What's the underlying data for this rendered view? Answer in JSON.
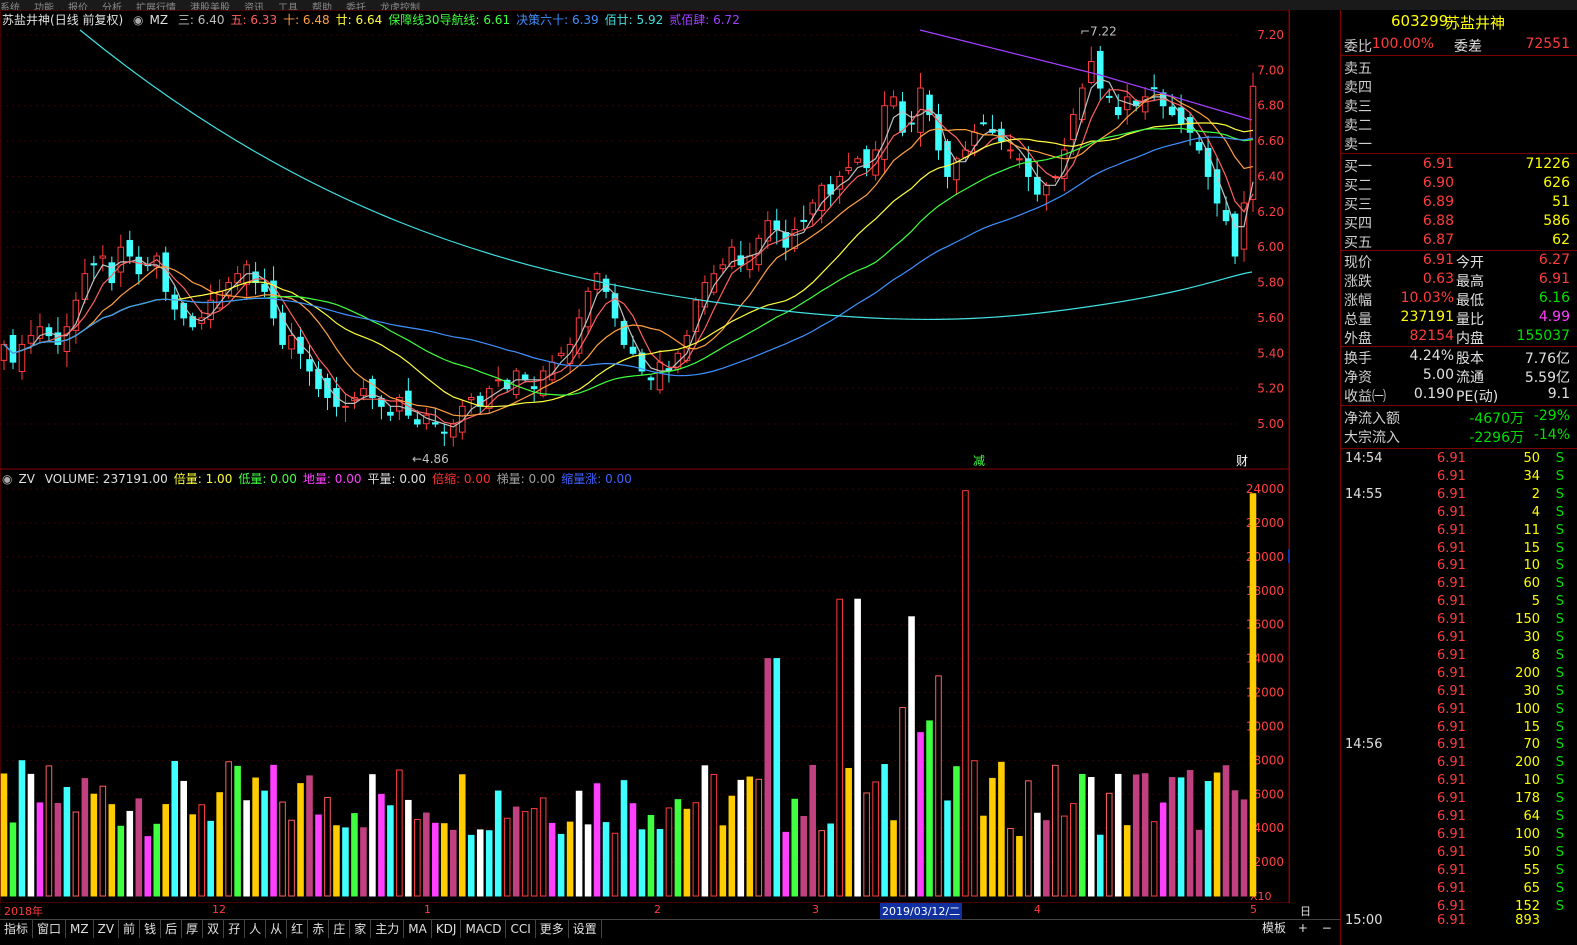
{
  "top_menu": [
    "系统",
    "功能",
    "报价",
    "分析",
    "扩展行情",
    "港股美股",
    "资讯",
    "工具",
    "帮助",
    "委托",
    "龙虎控制"
  ],
  "stock": {
    "name": "苏盐井神",
    "period": "(日线 前复权)",
    "code": "603299"
  },
  "ma_legend": {
    "prefix": "MZ",
    "items": [
      {
        "label": "三: 6.40",
        "color": "#c0c0c0"
      },
      {
        "label": "五: 6.33",
        "color": "#ff6060"
      },
      {
        "label": "十: 6.48",
        "color": "#ffa040"
      },
      {
        "label": "廿: 6.64",
        "color": "#ffff40"
      },
      {
        "label": "保障线30导航线: 6.61",
        "color": "#40ff40"
      },
      {
        "label": "决策六十: 6.39",
        "color": "#4090ff"
      },
      {
        "label": "佰廿: 5.92",
        "color": "#40e0e0"
      },
      {
        "label": "贰佰肆: 6.72",
        "color": "#a040ff"
      }
    ]
  },
  "vol_legend": {
    "prefix": "ZV",
    "items": [
      {
        "label": "VOLUME: 237191.00",
        "color": "#e0e0e0"
      },
      {
        "label": "倍量: 1.00",
        "color": "#ffff40"
      },
      {
        "label": "低量: 0.00",
        "color": "#40ff40"
      },
      {
        "label": "地量: 0.00",
        "color": "#ff40ff"
      },
      {
        "label": "平量: 0.00",
        "color": "#e0e0e0"
      },
      {
        "label": "倍缩: 0.00",
        "color": "#ff3030"
      },
      {
        "label": "梯量: 0.00",
        "color": "#a0a0a0"
      },
      {
        "label": "缩量涨: 0.00",
        "color": "#4060ff"
      }
    ]
  },
  "price_axis": [
    "7.20",
    "7.00",
    "6.80",
    "6.60",
    "6.40",
    "6.20",
    "6.00",
    "5.80",
    "5.60",
    "5.40",
    "5.20",
    "5.00"
  ],
  "vol_axis": [
    "24000",
    "22000",
    "20000",
    "18000",
    "16000",
    "14000",
    "12000",
    "10000",
    "8000",
    "6000",
    "4000",
    "2000"
  ],
  "vol_marker": "20046",
  "vol_unit": "X10",
  "annotations": {
    "high": "7.22",
    "low": "4.86",
    "mark1": "减",
    "mark2": "财"
  },
  "date_axis": {
    "labels": [
      "2018年",
      "12",
      "1",
      "2",
      "3",
      "2019/03/12/二",
      "4",
      "5"
    ],
    "period": "日线"
  },
  "bottom_tabs": [
    "指标",
    "窗口",
    "MZ",
    "ZV",
    "前",
    "钱",
    "后",
    "厚",
    "双",
    "孖",
    "人",
    "从",
    "红",
    "赤",
    "庄",
    "家",
    "主力",
    "MA",
    "KDJ",
    "MACD",
    "CCI",
    "更多",
    "设置"
  ],
  "bottom_right": [
    "模板",
    "+",
    "−"
  ],
  "quote": {
    "code": "603299",
    "name": "苏盐井神",
    "weibi_label": "委比",
    "weibi": "100.00%",
    "weicha_label": "委差",
    "weicha": "72551",
    "sells": [
      "卖五",
      "卖四",
      "卖三",
      "卖二",
      "卖一"
    ],
    "buys": [
      {
        "label": "买一",
        "price": "6.91",
        "vol": "71226"
      },
      {
        "label": "买二",
        "price": "6.90",
        "vol": "626"
      },
      {
        "label": "买三",
        "price": "6.89",
        "vol": "51"
      },
      {
        "label": "买四",
        "price": "6.88",
        "vol": "586"
      },
      {
        "label": "买五",
        "price": "6.87",
        "vol": "62"
      }
    ],
    "stats": [
      {
        "l1": "现价",
        "v1": "6.91",
        "c1": "red",
        "l2": "今开",
        "v2": "6.27",
        "c2": "red"
      },
      {
        "l1": "涨跌",
        "v1": "0.63",
        "c1": "red",
        "l2": "最高",
        "v2": "6.91",
        "c2": "red"
      },
      {
        "l1": "涨幅",
        "v1": "10.03%",
        "c1": "red",
        "l2": "最低",
        "v2": "6.16",
        "c2": "green"
      },
      {
        "l1": "总量",
        "v1": "237191",
        "c1": "yellow",
        "l2": "量比",
        "v2": "4.99",
        "c2": "magenta"
      },
      {
        "l1": "外盘",
        "v1": "82154",
        "c1": "red",
        "l2": "内盘",
        "v2": "155037",
        "c2": "green"
      }
    ],
    "stats2": [
      {
        "l1": "换手",
        "v1": "4.24%",
        "l2": "股本",
        "v2": "7.76亿"
      },
      {
        "l1": "净资",
        "v1": "5.00",
        "l2": "流通",
        "v2": "5.59亿"
      },
      {
        "l1": "收益㈠",
        "v1": "0.190",
        "l2": "PE(动)",
        "v2": "9.1"
      }
    ],
    "flows": [
      {
        "label": "净流入额",
        "v1": "-4670万",
        "v2": "-29%"
      },
      {
        "label": "大宗流入",
        "v1": "-2296万",
        "v2": "-14%"
      }
    ]
  },
  "ticks": [
    {
      "time": "14:54",
      "price": "6.91",
      "vol": "50",
      "dir": "S"
    },
    {
      "time": "",
      "price": "6.91",
      "vol": "34",
      "dir": "S"
    },
    {
      "time": "14:55",
      "price": "6.91",
      "vol": "2",
      "dir": "S"
    },
    {
      "time": "",
      "price": "6.91",
      "vol": "4",
      "dir": "S"
    },
    {
      "time": "",
      "price": "6.91",
      "vol": "11",
      "dir": "S"
    },
    {
      "time": "",
      "price": "6.91",
      "vol": "15",
      "dir": "S"
    },
    {
      "time": "",
      "price": "6.91",
      "vol": "10",
      "dir": "S"
    },
    {
      "time": "",
      "price": "6.91",
      "vol": "60",
      "dir": "S"
    },
    {
      "time": "",
      "price": "6.91",
      "vol": "5",
      "dir": "S"
    },
    {
      "time": "",
      "price": "6.91",
      "vol": "150",
      "dir": "S"
    },
    {
      "time": "",
      "price": "6.91",
      "vol": "30",
      "dir": "S"
    },
    {
      "time": "",
      "price": "6.91",
      "vol": "8",
      "dir": "S"
    },
    {
      "time": "",
      "price": "6.91",
      "vol": "200",
      "dir": "S"
    },
    {
      "time": "",
      "price": "6.91",
      "vol": "30",
      "dir": "S"
    },
    {
      "time": "",
      "price": "6.91",
      "vol": "100",
      "dir": "S"
    },
    {
      "time": "",
      "price": "6.91",
      "vol": "15",
      "dir": "S"
    },
    {
      "time": "14:56",
      "price": "6.91",
      "vol": "70",
      "dir": "S"
    },
    {
      "time": "",
      "price": "6.91",
      "vol": "200",
      "dir": "S"
    },
    {
      "time": "",
      "price": "6.91",
      "vol": "10",
      "dir": "S"
    },
    {
      "time": "",
      "price": "6.91",
      "vol": "178",
      "dir": "S"
    },
    {
      "time": "",
      "price": "6.91",
      "vol": "64",
      "dir": "S"
    },
    {
      "time": "",
      "price": "6.91",
      "vol": "100",
      "dir": "S"
    },
    {
      "time": "",
      "price": "6.91",
      "vol": "50",
      "dir": "S"
    },
    {
      "time": "",
      "price": "6.91",
      "vol": "55",
      "dir": "S"
    },
    {
      "time": "",
      "price": "6.91",
      "vol": "65",
      "dir": "S"
    },
    {
      "time": "",
      "price": "6.91",
      "vol": "152",
      "dir": "S"
    },
    {
      "time": "15:00",
      "price": "6.91",
      "vol": "893",
      "dir": ""
    }
  ],
  "chart_data": {
    "type": "candlestick",
    "price_range": [
      4.86,
      7.22
    ],
    "volume_range": [
      0,
      24000
    ],
    "closes": [
      5.45,
      5.35,
      5.45,
      5.5,
      5.55,
      5.5,
      5.45,
      5.55,
      5.7,
      5.85,
      5.9,
      5.95,
      5.8,
      6.0,
      5.95,
      5.85,
      5.9,
      5.95,
      5.75,
      5.65,
      5.6,
      5.55,
      5.6,
      5.7,
      5.75,
      5.8,
      5.85,
      5.9,
      5.8,
      5.75,
      5.6,
      5.45,
      5.5,
      5.4,
      5.3,
      5.2,
      5.15,
      5.1,
      5.1,
      5.15,
      5.2,
      5.15,
      5.1,
      5.05,
      5.15,
      5.05,
      5.0,
      5.05,
      5.0,
      4.95,
      5.0,
      5.1,
      5.15,
      5.1,
      5.2,
      5.25,
      5.2,
      5.3,
      5.25,
      5.2,
      5.3,
      5.35,
      5.4,
      5.45,
      5.6,
      5.75,
      5.85,
      5.75,
      5.6,
      5.45,
      5.4,
      5.3,
      5.25,
      5.35,
      5.3,
      5.4,
      5.5,
      5.7,
      5.8,
      5.85,
      5.9,
      6.0,
      5.9,
      5.95,
      6.05,
      6.15,
      6.1,
      6.0,
      6.1,
      6.15,
      6.25,
      6.35,
      6.3,
      6.4,
      6.45,
      6.5,
      6.45,
      6.55,
      6.8,
      6.85,
      6.65,
      6.7,
      6.9,
      6.75,
      6.55,
      6.4,
      6.5,
      6.55,
      6.65,
      6.7,
      6.65,
      6.6,
      6.55,
      6.5,
      6.4,
      6.3,
      6.35,
      6.4,
      6.55,
      6.75,
      6.9,
      7.05,
      6.9,
      6.85,
      6.75,
      6.85,
      6.8,
      6.85,
      6.9,
      6.8,
      6.75,
      6.7,
      6.65,
      6.55,
      6.4,
      6.25,
      6.15,
      5.95,
      6.25,
      6.91
    ]
  }
}
